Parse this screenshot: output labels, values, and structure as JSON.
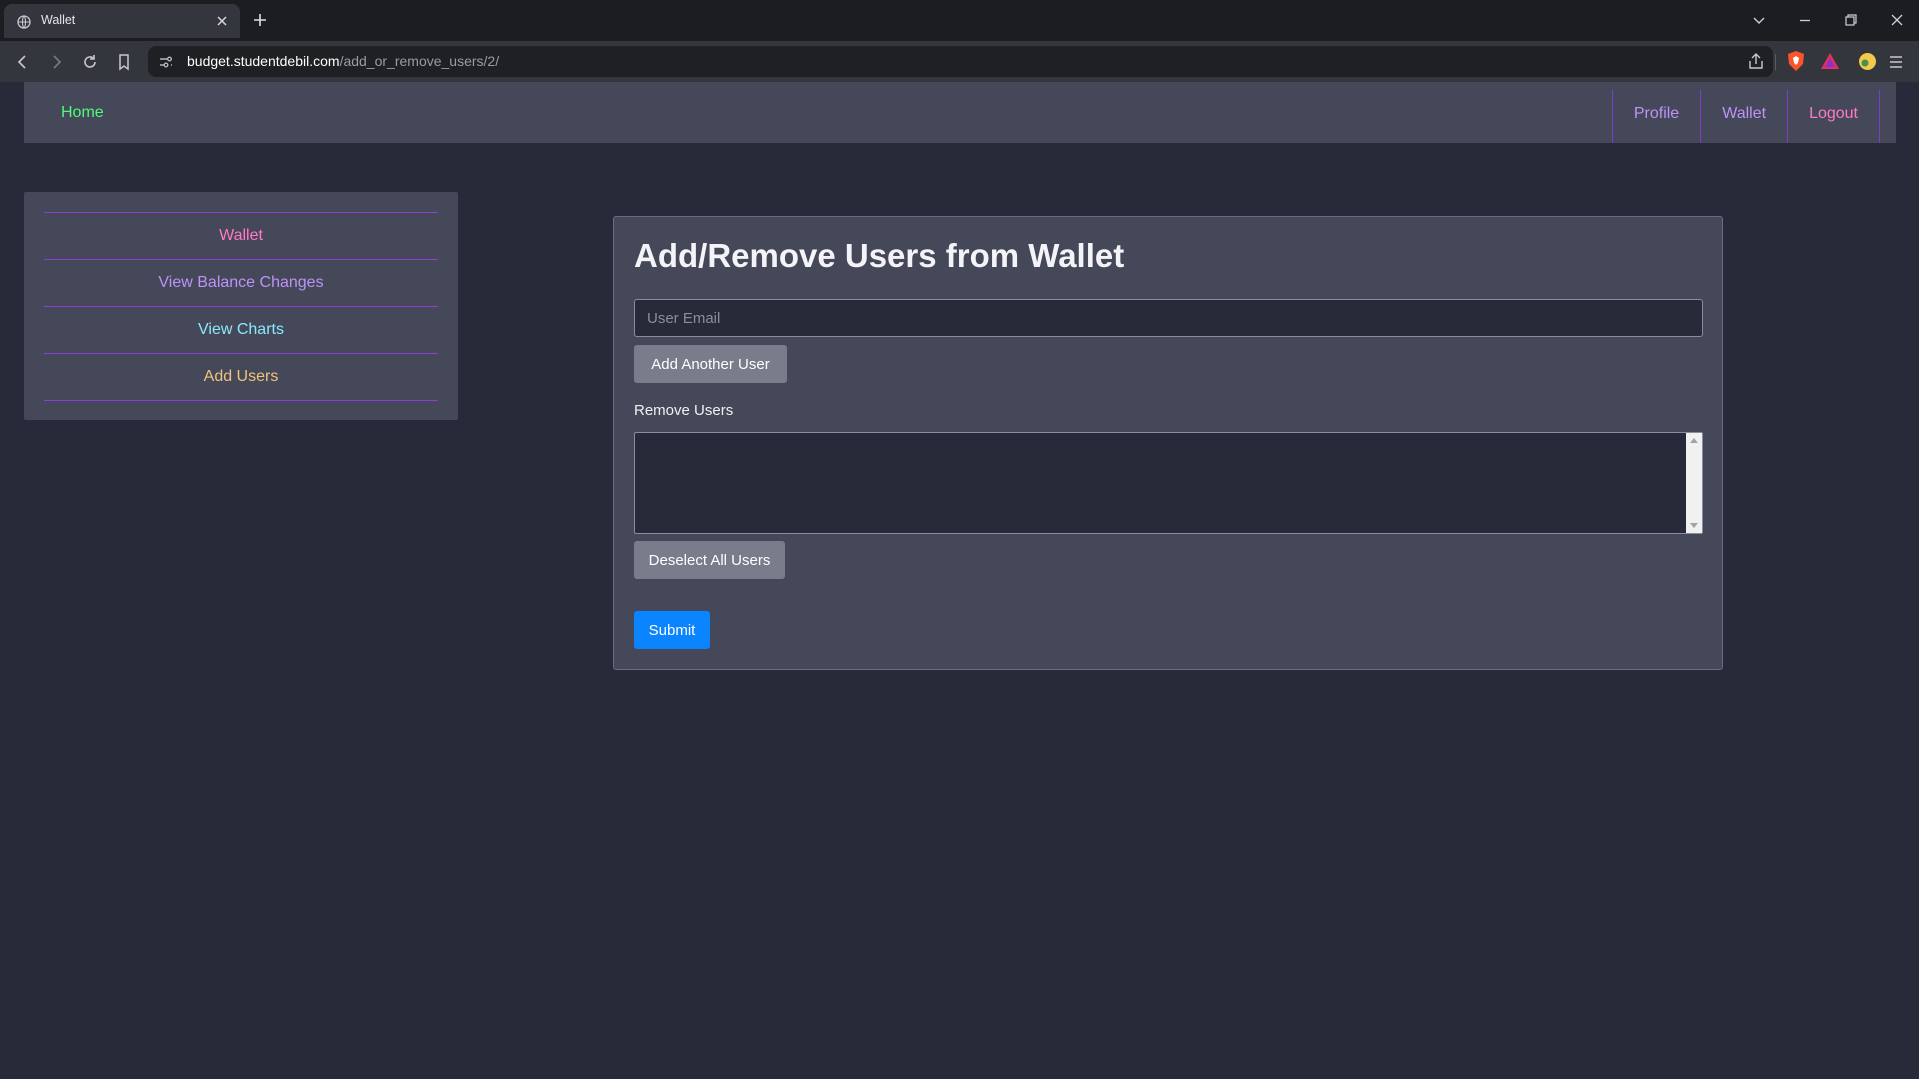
{
  "browser": {
    "tab_title": "Wallet",
    "url_host": "budget.studentdebil.com",
    "url_path": "/add_or_remove_users/2/"
  },
  "topnav": {
    "home": "Home",
    "profile": "Profile",
    "wallet": "Wallet",
    "logout": "Logout",
    "colors": {
      "home": "#50fa7b",
      "profile": "#bd93f9",
      "wallet": "#bd93f9",
      "logout": "#ff79c6"
    }
  },
  "sidebar": {
    "items": [
      {
        "label": "Wallet",
        "color": "#ff79c6"
      },
      {
        "label": "View Balance Changes",
        "color": "#bd93f9"
      },
      {
        "label": "View Charts",
        "color": "#8be9fd"
      },
      {
        "label": "Add Users",
        "color": "#f1c27d"
      }
    ]
  },
  "form": {
    "title": "Add/Remove Users from Wallet",
    "email_placeholder": "User Email",
    "email_value": "",
    "add_another_label": "Add Another User",
    "remove_label": "Remove Users",
    "remove_options": [],
    "deselect_label": "Deselect All Users",
    "submit_label": "Submit",
    "submit_color": "#0a84ff"
  },
  "theme": {
    "page_bg": "#282a3a",
    "panel_bg": "#454858",
    "divider": "#8a3fd6"
  }
}
